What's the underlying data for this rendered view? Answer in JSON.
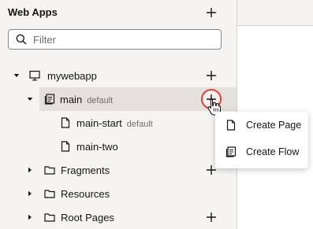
{
  "panel": {
    "title": "Web Apps",
    "add_icon": "plus-icon"
  },
  "search": {
    "placeholder": "Filter",
    "value": "",
    "icon": "search-icon"
  },
  "tree": {
    "app": {
      "label": "mywebapp",
      "icon": "monitor-icon",
      "expanded": true
    },
    "main": {
      "label": "main",
      "tag": "default",
      "icon": "flow-icon",
      "expanded": true,
      "selected": true
    },
    "main_start": {
      "label": "main-start",
      "tag": "default",
      "icon": "page-icon"
    },
    "main_two": {
      "label": "main-two",
      "icon": "page-icon"
    },
    "fragments": {
      "label": "Fragments",
      "icon": "folder-icon",
      "expanded": false
    },
    "resources": {
      "label": "Resources",
      "icon": "folder-icon",
      "expanded": false
    },
    "root_pages": {
      "label": "Root Pages",
      "icon": "folder-icon",
      "expanded": false
    }
  },
  "menu": {
    "create_page": "Create Page",
    "create_flow": "Create Flow"
  },
  "colors": {
    "panel_bg": "#f5f4f2",
    "selected_bg": "#e4e1dd",
    "highlight": "#d9453a",
    "text": "#161513"
  }
}
